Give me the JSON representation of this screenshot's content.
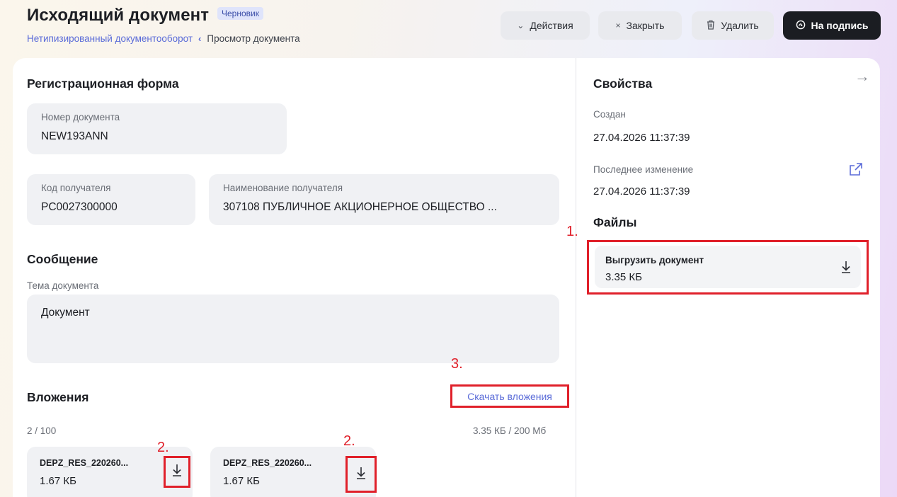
{
  "header": {
    "title": "Исходящий документ",
    "status": "Черновик",
    "breadcrumb": {
      "link": "Нетипизированный документооборот",
      "separator": "‹",
      "current": "Просмотр документа"
    }
  },
  "toolbar": {
    "actions_label": "Действия",
    "close_label": "Закрыть",
    "delete_label": "Удалить",
    "sign_label": "На подпись",
    "actions_icon": "⌄",
    "close_icon": "×"
  },
  "registration": {
    "title": "Регистрационная форма",
    "doc_number_label": "Номер документа",
    "doc_number": "NEW193ANN",
    "recipient_code_label": "Код получателя",
    "recipient_code": "PC0027300000",
    "recipient_name_label": "Наименование получателя",
    "recipient_name": "307108 ПУБЛИЧНОЕ АКЦИОНЕРНОЕ ОБЩЕСТВО ..."
  },
  "message": {
    "title": "Сообщение",
    "subject_label": "Тема документа",
    "subject": "Документ"
  },
  "attachments": {
    "title": "Вложения",
    "download_all": "Скачать вложения",
    "count": "2 / 100",
    "size_used": "3.35 КБ / 200 Мб",
    "items": [
      {
        "name": "DEPZ_RES_220260...",
        "size": "1.67 КБ"
      },
      {
        "name": "DEPZ_RES_220260...",
        "size": "1.67 КБ"
      }
    ]
  },
  "properties": {
    "title": "Свойства",
    "created_label": "Создан",
    "created": "27.04.2026 11:37:39",
    "modified_label": "Последнее изменение",
    "modified": "27.04.2026 11:37:39",
    "collapse_icon": "→",
    "files_title": "Файлы",
    "export_title": "Выгрузить документ",
    "export_size": "3.35 КБ"
  },
  "annotations": {
    "a1": "1.",
    "a2": "2.",
    "a3": "3."
  },
  "colors": {
    "annotation": "#e0202a",
    "link": "#5a6bd8",
    "dark_button": "#1b1d22"
  }
}
